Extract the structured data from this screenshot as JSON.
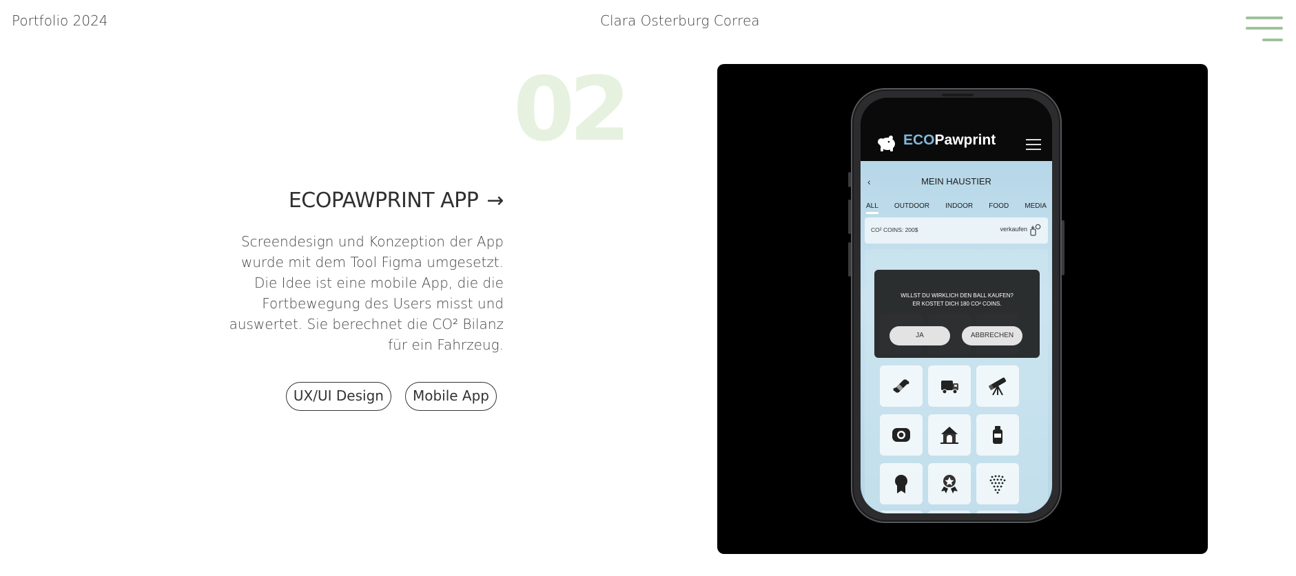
{
  "header": {
    "left_text": "Portfolio 2024",
    "center_text": "Clara Osterburg Correa",
    "menu_icon": "hamburger-icon",
    "accent_color": "#9dc39b"
  },
  "project": {
    "number": "02",
    "number_color": "#e6f1df",
    "title": "ECOPAWPRINT APP",
    "arrow": "→",
    "description": "Screendesign und Konzeption der App wurde mit dem Tool Figma umgesetzt. Die Idee ist eine mobile App, die die Fortbewegung des Users misst und auswertet. Sie berechnet die CO² Bilanz für ein Fahrzeug.",
    "tags": [
      "UX/UI Design",
      "Mobile App"
    ]
  },
  "phone_app": {
    "brand_prefix": "ECO",
    "brand_suffix": "Pawprint",
    "brand_color": "#7fb8da",
    "back_glyph": "‹",
    "page_title": "MEIN HAUSTIER",
    "tabs": [
      "ALL",
      "OUTDOOR",
      "INDOOR",
      "FOOD",
      "MEDIA"
    ],
    "active_tab": "ALL",
    "coins_label": "CO² COINS: 200$",
    "sell_label": "verkaufen",
    "modal": {
      "line1": "WILLST DU WIRKLICH DEN BALL KAUFEN?",
      "line2": "ER KOSTET DICH 180 CO² COINS.",
      "yes": "JA",
      "cancel": "ABBRECHEN"
    },
    "item_icons": [
      "skateboard-icon",
      "truck-icon",
      "telescope-icon",
      "tire-icon",
      "doghouse-icon",
      "bottle-icon",
      "medal-icon",
      "award-icon",
      "dots-icon"
    ]
  }
}
